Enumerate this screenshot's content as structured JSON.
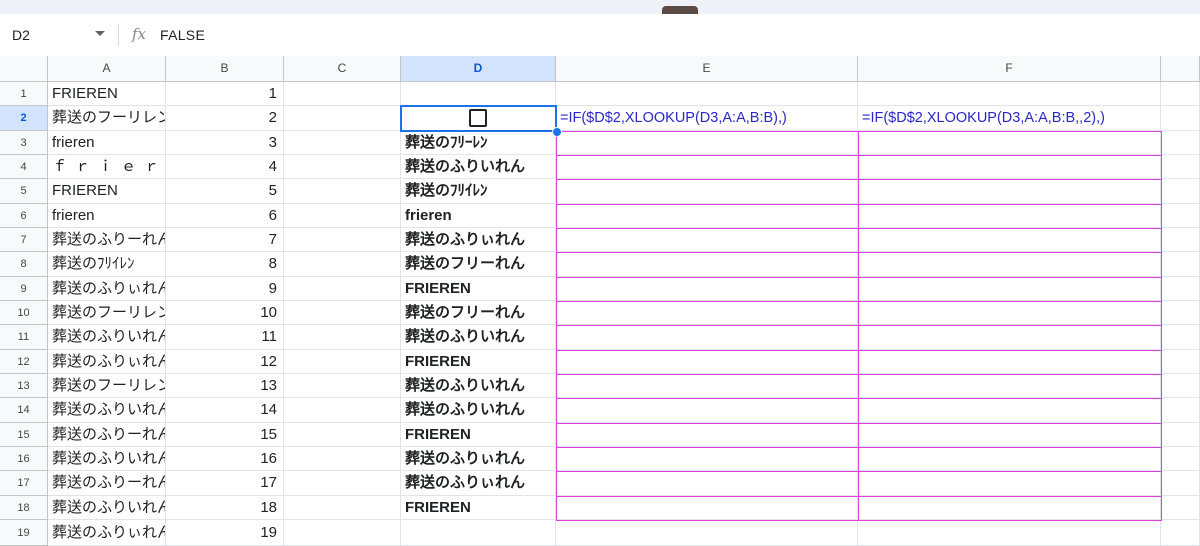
{
  "name_box": {
    "ref": "D2"
  },
  "formula_bar": {
    "fx": "fx",
    "value": "FALSE"
  },
  "columns": [
    "A",
    "B",
    "C",
    "D",
    "E",
    "F"
  ],
  "selected_column": "D",
  "selected_row": "2",
  "rows": [
    {
      "n": "1",
      "a": "FRIEREN",
      "b": "1",
      "d": "",
      "e": "",
      "f": ""
    },
    {
      "n": "2",
      "a": "葬送のフーリレン",
      "b": "2",
      "d": "",
      "e": "=IF($D$2,XLOOKUP(D3,A:A,B:B),)",
      "f": "=IF($D$2,XLOOKUP(D3,A:A,B:B,,2),)"
    },
    {
      "n": "3",
      "a": "frieren",
      "b": "3",
      "d": "葬送のﾌﾘｰﾚﾝ",
      "e": "",
      "f": ""
    },
    {
      "n": "4",
      "a": "ｆｒｉｅｒｅｎ",
      "b": "4",
      "d": "葬送のふりいれん",
      "e": "",
      "f": ""
    },
    {
      "n": "5",
      "a": "FRIEREN",
      "b": "5",
      "d": "葬送のﾌﾘｲﾚﾝ",
      "e": "",
      "f": ""
    },
    {
      "n": "6",
      "a": "frieren",
      "b": "6",
      "d": "frieren",
      "e": "",
      "f": ""
    },
    {
      "n": "7",
      "a": "葬送のふりーれん",
      "b": "7",
      "d": "葬送のふりぃれん",
      "e": "",
      "f": ""
    },
    {
      "n": "8",
      "a": "葬送のﾌﾘｲﾚﾝ",
      "b": "8",
      "d": "葬送のフリーれん",
      "e": "",
      "f": ""
    },
    {
      "n": "9",
      "a": "葬送のふりぃれん",
      "b": "9",
      "d": "FRIEREN",
      "e": "",
      "f": ""
    },
    {
      "n": "10",
      "a": "葬送のフーリレン",
      "b": "10",
      "d": "葬送のフリーれん",
      "e": "",
      "f": ""
    },
    {
      "n": "11",
      "a": "葬送のふりいれん",
      "b": "11",
      "d": "葬送のふりいれん",
      "e": "",
      "f": ""
    },
    {
      "n": "12",
      "a": "葬送のふりぃれん",
      "b": "12",
      "d": "FRIEREN",
      "e": "",
      "f": ""
    },
    {
      "n": "13",
      "a": "葬送のフーリレン",
      "b": "13",
      "d": "葬送のふりいれん",
      "e": "",
      "f": ""
    },
    {
      "n": "14",
      "a": "葬送のふりいれん",
      "b": "14",
      "d": "葬送のふりいれん",
      "e": "",
      "f": ""
    },
    {
      "n": "15",
      "a": "葬送のふりーれん",
      "b": "15",
      "d": "FRIEREN",
      "e": "",
      "f": ""
    },
    {
      "n": "16",
      "a": "葬送のふりいれん",
      "b": "16",
      "d": "葬送のふりぃれん",
      "e": "",
      "f": ""
    },
    {
      "n": "17",
      "a": "葬送のふりーれん",
      "b": "17",
      "d": "葬送のふりぃれん",
      "e": "",
      "f": ""
    },
    {
      "n": "18",
      "a": "葬送のふりいれん",
      "b": "18",
      "d": "FRIEREN",
      "e": "",
      "f": ""
    },
    {
      "n": "19",
      "a": "葬送のふりぃれん",
      "b": "19",
      "d": "",
      "e": "",
      "f": ""
    }
  ],
  "d2_checkbox": {
    "checked": false
  },
  "colors": {
    "selection": "#1a73e8",
    "highlight_border": "#e040e0",
    "formula_text": "#2b27c9",
    "header_selected": "#d3e3fd"
  }
}
